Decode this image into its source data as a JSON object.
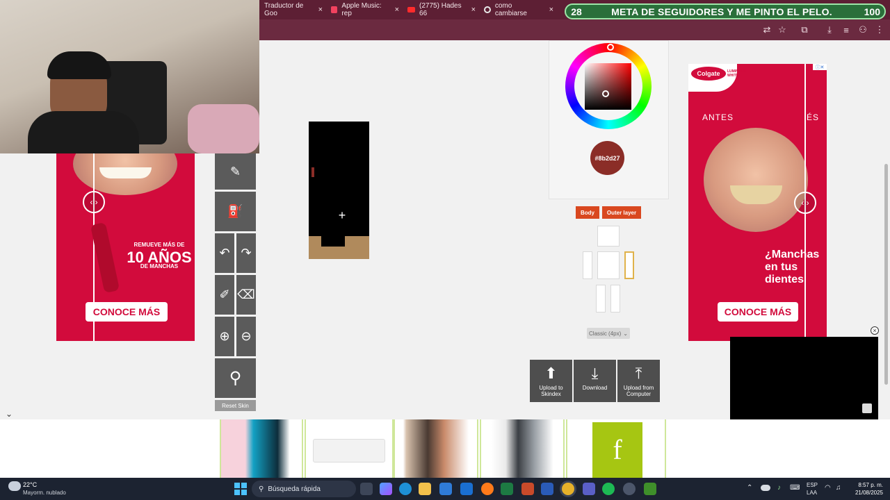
{
  "browser": {
    "tabs": [
      {
        "label": "Traductor de Goo",
        "icon": "translate-icon"
      },
      {
        "label": "Apple Music: rep",
        "icon": "music-icon"
      },
      {
        "label": "(2775) Hades 66",
        "icon": "youtube-icon"
      },
      {
        "label": "como cambiarse",
        "icon": "google-icon"
      }
    ],
    "tab_close": "×"
  },
  "goal_overlay": {
    "current": "28",
    "text": "META DE SEGUIDORES Y ME PINTO EL PELO.",
    "target": "100"
  },
  "color_picker": {
    "hex": "#8b2d27"
  },
  "layer_buttons": {
    "body": "Body",
    "outer": "Outer layer"
  },
  "model_select": {
    "value": "Classic (4px)"
  },
  "reset_label": "Reset Skin",
  "actions": {
    "upload_skindex": "Upload to Skindex",
    "download": "Download",
    "upload_computer": "Upload from Computer"
  },
  "ad_left": {
    "text1": "REMUEVE MÁS DE",
    "text2": "10 AÑOS",
    "text3": "DE MANCHAS",
    "cta": "CONOCE MÁS"
  },
  "ad_right": {
    "brand": "Colgate",
    "brand_sub": "LUMINOUS WHITE",
    "before": "ANTES",
    "after": "ÉS",
    "text": "¿Manchas en tus dientes",
    "cta": "CONOCE MÁS"
  },
  "taskbar": {
    "weather_temp": "22°C",
    "weather_desc": "Mayorm. nublado",
    "search": "Búsqueda rápida",
    "lang1": "ESP",
    "lang2": "LAA",
    "time": "8:57 p. m.",
    "date": "21/08/2025"
  },
  "colors": {
    "accent": "#d9481f",
    "ad_red": "#d20b3c",
    "tab_bg": "#5d1f34",
    "goal_green": "#2a6f3a"
  }
}
